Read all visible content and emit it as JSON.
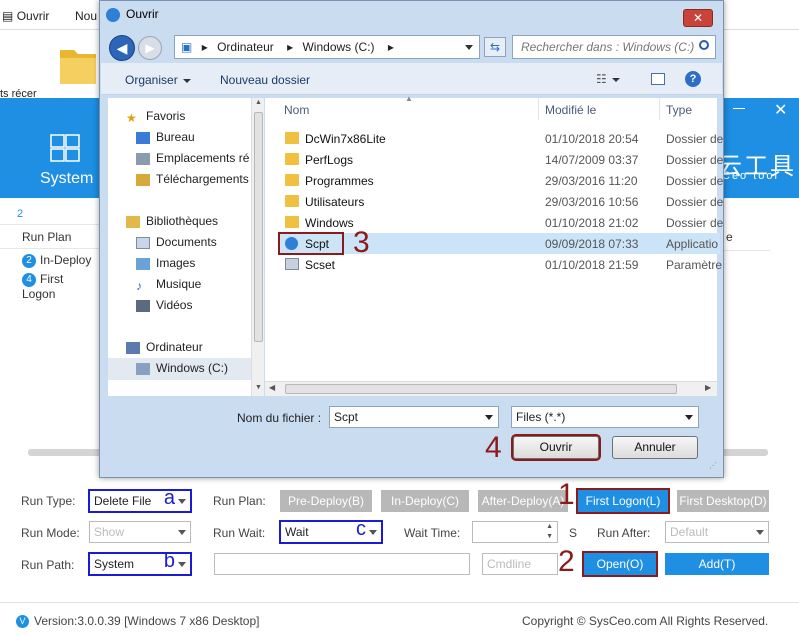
{
  "background": {
    "topbar": {
      "ouvrir": "Ouvrir",
      "nouveau": "Nou"
    },
    "recent": "ts récer",
    "system_label": "System",
    "brand": "云工具",
    "brand_sub": "Ceo tool",
    "plan_count": "2",
    "run_plan_header": "Run Plan",
    "plans": [
      {
        "num": "2",
        "label": "In-Deploy"
      },
      {
        "num": "4",
        "label": "First Logon"
      }
    ],
    "col_e": "e"
  },
  "form": {
    "run_type_label": "Run Type:",
    "run_type_value": "Delete File",
    "run_type_marker": "a",
    "run_plan_label": "Run Plan:",
    "plan_buttons": [
      "Pre-Deploy(B)",
      "In-Deploy(C)",
      "After-Deploy(A)",
      "First Logon(L)",
      "First Desktop(D)"
    ],
    "run_mode_label": "Run Mode:",
    "run_mode_value": "Show",
    "run_wait_label": "Run Wait:",
    "run_wait_value": "Wait",
    "run_wait_marker": "c",
    "wait_time_label": "Wait Time:",
    "wait_time_unit": "S",
    "run_after_label": "Run After:",
    "run_after_value": "Default",
    "run_path_label": "Run Path:",
    "run_path_value": "System",
    "run_path_marker": "b",
    "cmdline_placeholder": "Cmdline",
    "open_button": "Open(O)",
    "add_button": "Add(T)",
    "markers": {
      "m1": "1",
      "m2": "2",
      "m3": "3",
      "m4": "4"
    }
  },
  "footer": {
    "version": "Version:3.0.0.39 [Windows 7 x86 Desktop]",
    "copyright": "Copyright © SysCeo.com All Rights Reserved."
  },
  "dialog": {
    "title": "Ouvrir",
    "close": "✕",
    "breadcrumb": [
      "Ordinateur",
      "Windows (C:)"
    ],
    "search_placeholder": "Rechercher dans : Windows (C:)",
    "toolbar": {
      "organize": "Organiser",
      "new_folder": "Nouveau dossier",
      "help": "?"
    },
    "nav": {
      "favorites": "Favoris",
      "bureau": "Bureau",
      "emplacements": "Emplacements ré",
      "telechargements": "Téléchargements",
      "bibliotheques": "Bibliothèques",
      "documents": "Documents",
      "images": "Images",
      "musique": "Musique",
      "videos": "Vidéos",
      "ordinateur": "Ordinateur",
      "windows_c": "Windows (C:)"
    },
    "columns": {
      "name": "Nom",
      "modified": "Modifié le",
      "type": "Type"
    },
    "files": [
      {
        "name": "DcWin7x86Lite",
        "date": "01/10/2018 20:54",
        "type": "Dossier de"
      },
      {
        "name": "PerfLogs",
        "date": "14/07/2009 03:37",
        "type": "Dossier de"
      },
      {
        "name": "Programmes",
        "date": "29/03/2016 11:20",
        "type": "Dossier de"
      },
      {
        "name": "Utilisateurs",
        "date": "29/03/2016 10:56",
        "type": "Dossier de"
      },
      {
        "name": "Windows",
        "date": "01/10/2018 21:02",
        "type": "Dossier de"
      },
      {
        "name": "Scpt",
        "date": "09/09/2018 07:33",
        "type": "Applicatio"
      },
      {
        "name": "Scset",
        "date": "01/10/2018 21:59",
        "type": "Paramètre"
      }
    ],
    "filename_label": "Nom du fichier :",
    "filename_value": "Scpt",
    "filetype_value": "Files (*.*)",
    "open_button": "Ouvrir",
    "cancel_button": "Annuler"
  },
  "colors": {
    "accent": "#1e8fe3",
    "marker_red": "#8b1a1a",
    "marker_blue": "#1a1ad8"
  }
}
